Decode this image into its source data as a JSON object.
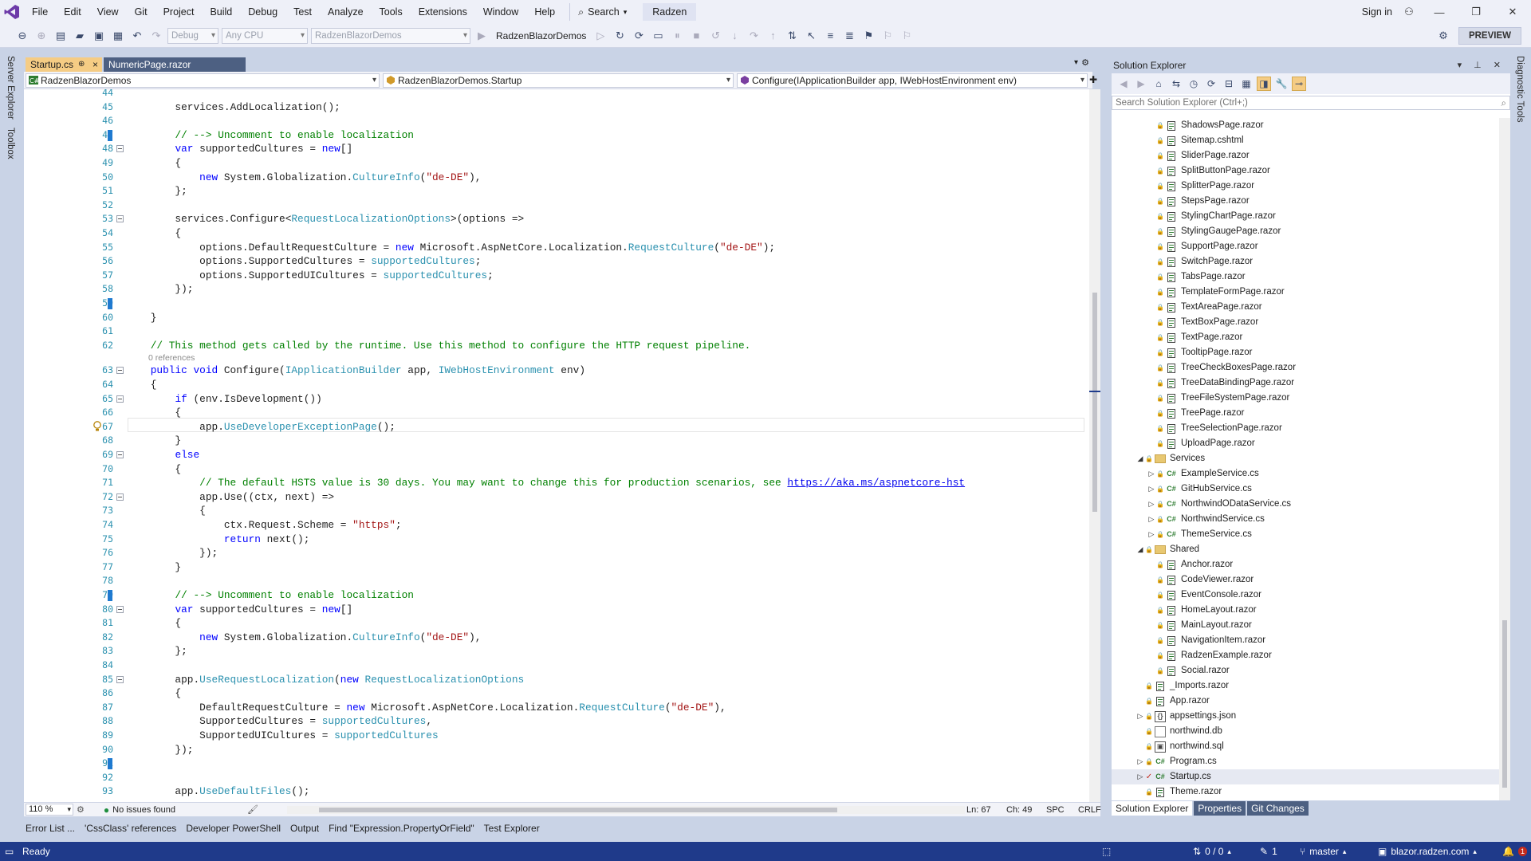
{
  "menubar": {
    "items": [
      "File",
      "Edit",
      "View",
      "Git",
      "Project",
      "Build",
      "Debug",
      "Test",
      "Analyze",
      "Tools",
      "Extensions",
      "Window",
      "Help"
    ],
    "search_label": "Search",
    "solution_name": "Radzen",
    "sign_in": "Sign in"
  },
  "toolbar": {
    "config": "Debug",
    "platform": "Any CPU",
    "startup_project": "RadzenBlazorDemos",
    "run_target": "RadzenBlazorDemos",
    "preview_label": "PREVIEW"
  },
  "left_rail": {
    "server_explorer": "Server Explorer",
    "toolbox": "Toolbox"
  },
  "right_rail": {
    "diagnostic_tools": "Diagnostic Tools"
  },
  "tabs": {
    "active": "Startup.cs",
    "active_pin": "⊕",
    "active_close": "×",
    "other": "NumericPage.razor"
  },
  "navbar": {
    "project": "RadzenBlazorDemos",
    "type": "RadzenBlazorDemos.Startup",
    "member": "Configure(IApplicationBuilder app, IWebHostEnvironment env)"
  },
  "editor": {
    "line_numbers": [
      "44",
      "45",
      "46",
      "47",
      "48",
      "49",
      "50",
      "51",
      "52",
      "53",
      "54",
      "55",
      "56",
      "57",
      "58",
      "59",
      "60",
      "61",
      "62",
      "63",
      "64",
      "65",
      "66",
      "67",
      "68",
      "69",
      "70",
      "71",
      "72",
      "73",
      "74",
      "75",
      "76",
      "77",
      "78",
      "79",
      "80",
      "81",
      "82",
      "83",
      "84",
      "85",
      "86",
      "87",
      "88",
      "89",
      "90",
      "91",
      "92",
      "93"
    ],
    "references_hint": "0 references",
    "lines": [
      [
        {
          "t": ""
        }
      ],
      [
        {
          "t": "        services."
        },
        {
          "t": "AddLocalization"
        },
        {
          "t": "();"
        }
      ],
      [
        {
          "t": ""
        }
      ],
      [
        {
          "t": "        "
        },
        {
          "t": "// --> Uncomment to enable localization",
          "c": "cm"
        }
      ],
      [
        {
          "t": "        "
        },
        {
          "t": "var",
          "c": "kw"
        },
        {
          "t": " supportedCultures = "
        },
        {
          "t": "new",
          "c": "kw"
        },
        {
          "t": "[]"
        }
      ],
      [
        {
          "t": "        {"
        }
      ],
      [
        {
          "t": "            "
        },
        {
          "t": "new",
          "c": "kw"
        },
        {
          "t": " System.Globalization."
        },
        {
          "t": "CultureInfo",
          "c": "ty"
        },
        {
          "t": "("
        },
        {
          "t": "\"de-DE\"",
          "c": "str"
        },
        {
          "t": "),"
        }
      ],
      [
        {
          "t": "        };"
        }
      ],
      [
        {
          "t": ""
        }
      ],
      [
        {
          "t": "        services."
        },
        {
          "t": "Configure"
        },
        {
          "t": "<"
        },
        {
          "t": "RequestLocalizationOptions",
          "c": "ty"
        },
        {
          "t": ">(options =>"
        }
      ],
      [
        {
          "t": "        {"
        }
      ],
      [
        {
          "t": "            options.DefaultRequestCulture = "
        },
        {
          "t": "new",
          "c": "kw"
        },
        {
          "t": " Microsoft.AspNetCore.Localization."
        },
        {
          "t": "RequestCulture",
          "c": "ty"
        },
        {
          "t": "("
        },
        {
          "t": "\"de-DE\"",
          "c": "str"
        },
        {
          "t": ");"
        }
      ],
      [
        {
          "t": "            options.SupportedCultures = "
        },
        {
          "t": "supportedCultures",
          "c": "ty"
        },
        {
          "t": ";"
        }
      ],
      [
        {
          "t": "            options.SupportedUICultures = "
        },
        {
          "t": "supportedCultures",
          "c": "ty"
        },
        {
          "t": ";"
        }
      ],
      [
        {
          "t": "        });"
        }
      ],
      [
        {
          "t": ""
        }
      ],
      [
        {
          "t": "    }"
        }
      ],
      [
        {
          "t": ""
        }
      ],
      [
        {
          "t": "    "
        },
        {
          "t": "// This method gets called by the runtime. Use this method to configure the HTTP request pipeline.",
          "c": "cm"
        }
      ],
      [
        {
          "t": "    "
        },
        {
          "t": "public",
          "c": "kw"
        },
        {
          "t": " "
        },
        {
          "t": "void",
          "c": "kw"
        },
        {
          "t": " Configure("
        },
        {
          "t": "IApplicationBuilder",
          "c": "ty"
        },
        {
          "t": " app, "
        },
        {
          "t": "IWebHostEnvironment",
          "c": "ty"
        },
        {
          "t": " env)"
        }
      ],
      [
        {
          "t": "    {"
        }
      ],
      [
        {
          "t": "        "
        },
        {
          "t": "if",
          "c": "kw"
        },
        {
          "t": " (env.IsDevelopment())"
        }
      ],
      [
        {
          "t": "        {"
        }
      ],
      [
        {
          "t": "            app."
        },
        {
          "t": "UseDeveloperExceptionPage",
          "c": "ty"
        },
        {
          "t": "();"
        }
      ],
      [
        {
          "t": "        }"
        }
      ],
      [
        {
          "t": "        "
        },
        {
          "t": "else",
          "c": "kw"
        }
      ],
      [
        {
          "t": "        {"
        }
      ],
      [
        {
          "t": "            "
        },
        {
          "t": "// The default HSTS value is 30 days. You may want to change this for production scenarios, see ",
          "c": "cm"
        },
        {
          "t": "https://aka.ms/aspnetcore-hst",
          "c": "link"
        }
      ],
      [
        {
          "t": "            app."
        },
        {
          "t": "Use"
        },
        {
          "t": "((ctx, next) =>"
        }
      ],
      [
        {
          "t": "            {"
        }
      ],
      [
        {
          "t": "                ctx.Request.Scheme = "
        },
        {
          "t": "\"https\"",
          "c": "str"
        },
        {
          "t": ";"
        }
      ],
      [
        {
          "t": "                "
        },
        {
          "t": "return",
          "c": "kw"
        },
        {
          "t": " next();"
        }
      ],
      [
        {
          "t": "            });"
        }
      ],
      [
        {
          "t": "        }"
        }
      ],
      [
        {
          "t": ""
        }
      ],
      [
        {
          "t": "        "
        },
        {
          "t": "// --> Uncomment to enable localization",
          "c": "cm"
        }
      ],
      [
        {
          "t": "        "
        },
        {
          "t": "var",
          "c": "kw"
        },
        {
          "t": " supportedCultures = "
        },
        {
          "t": "new",
          "c": "kw"
        },
        {
          "t": "[]"
        }
      ],
      [
        {
          "t": "        {"
        }
      ],
      [
        {
          "t": "            "
        },
        {
          "t": "new",
          "c": "kw"
        },
        {
          "t": " System.Globalization."
        },
        {
          "t": "CultureInfo",
          "c": "ty"
        },
        {
          "t": "("
        },
        {
          "t": "\"de-DE\"",
          "c": "str"
        },
        {
          "t": "),"
        }
      ],
      [
        {
          "t": "        };"
        }
      ],
      [
        {
          "t": ""
        }
      ],
      [
        {
          "t": "        app."
        },
        {
          "t": "UseRequestLocalization",
          "c": "ty"
        },
        {
          "t": "("
        },
        {
          "t": "new",
          "c": "kw"
        },
        {
          "t": " "
        },
        {
          "t": "RequestLocalizationOptions",
          "c": "ty"
        }
      ],
      [
        {
          "t": "        {"
        }
      ],
      [
        {
          "t": "            DefaultRequestCulture = "
        },
        {
          "t": "new",
          "c": "kw"
        },
        {
          "t": " Microsoft.AspNetCore.Localization."
        },
        {
          "t": "RequestCulture",
          "c": "ty"
        },
        {
          "t": "("
        },
        {
          "t": "\"de-DE\"",
          "c": "str"
        },
        {
          "t": "),"
        }
      ],
      [
        {
          "t": "            SupportedCultures = "
        },
        {
          "t": "supportedCultures",
          "c": "ty"
        },
        {
          "t": ","
        }
      ],
      [
        {
          "t": "            SupportedUICultures = "
        },
        {
          "t": "supportedCultures",
          "c": "ty"
        }
      ],
      [
        {
          "t": "        });"
        }
      ],
      [
        {
          "t": ""
        }
      ],
      [
        {
          "t": ""
        }
      ],
      [
        {
          "t": "        app."
        },
        {
          "t": "UseDefaultFiles",
          "c": "ty"
        },
        {
          "t": "();"
        }
      ]
    ]
  },
  "editor_status": {
    "zoom": "110 %",
    "issues": "No issues found",
    "ln": "Ln: 67",
    "ch": "Ch: 49",
    "mode": "SPC",
    "eol": "CRLF"
  },
  "solution_explorer": {
    "title": "Solution Explorer",
    "search_placeholder": "Search Solution Explorer (Ctrl+;)",
    "items": [
      {
        "label": "ShadowsPage.razor",
        "level": 3,
        "type": "razor",
        "exp": ""
      },
      {
        "label": "Sitemap.cshtml",
        "level": 3,
        "type": "razor",
        "exp": ""
      },
      {
        "label": "SliderPage.razor",
        "level": 3,
        "type": "razor",
        "exp": ""
      },
      {
        "label": "SplitButtonPage.razor",
        "level": 3,
        "type": "razor",
        "exp": ""
      },
      {
        "label": "SplitterPage.razor",
        "level": 3,
        "type": "razor",
        "exp": ""
      },
      {
        "label": "StepsPage.razor",
        "level": 3,
        "type": "razor",
        "exp": ""
      },
      {
        "label": "StylingChartPage.razor",
        "level": 3,
        "type": "razor",
        "exp": ""
      },
      {
        "label": "StylingGaugePage.razor",
        "level": 3,
        "type": "razor",
        "exp": ""
      },
      {
        "label": "SupportPage.razor",
        "level": 3,
        "type": "razor",
        "exp": ""
      },
      {
        "label": "SwitchPage.razor",
        "level": 3,
        "type": "razor",
        "exp": ""
      },
      {
        "label": "TabsPage.razor",
        "level": 3,
        "type": "razor",
        "exp": ""
      },
      {
        "label": "TemplateFormPage.razor",
        "level": 3,
        "type": "razor",
        "exp": ""
      },
      {
        "label": "TextAreaPage.razor",
        "level": 3,
        "type": "razor",
        "exp": ""
      },
      {
        "label": "TextBoxPage.razor",
        "level": 3,
        "type": "razor",
        "exp": ""
      },
      {
        "label": "TextPage.razor",
        "level": 3,
        "type": "razor",
        "exp": ""
      },
      {
        "label": "TooltipPage.razor",
        "level": 3,
        "type": "razor",
        "exp": ""
      },
      {
        "label": "TreeCheckBoxesPage.razor",
        "level": 3,
        "type": "razor",
        "exp": ""
      },
      {
        "label": "TreeDataBindingPage.razor",
        "level": 3,
        "type": "razor",
        "exp": ""
      },
      {
        "label": "TreeFileSystemPage.razor",
        "level": 3,
        "type": "razor",
        "exp": ""
      },
      {
        "label": "TreePage.razor",
        "level": 3,
        "type": "razor",
        "exp": ""
      },
      {
        "label": "TreeSelectionPage.razor",
        "level": 3,
        "type": "razor",
        "exp": ""
      },
      {
        "label": "UploadPage.razor",
        "level": 3,
        "type": "razor",
        "exp": ""
      },
      {
        "label": "Services",
        "level": 2,
        "type": "folder",
        "exp": "◢"
      },
      {
        "label": "ExampleService.cs",
        "level": 3,
        "type": "cs",
        "exp": "▷"
      },
      {
        "label": "GitHubService.cs",
        "level": 3,
        "type": "cs",
        "exp": "▷"
      },
      {
        "label": "NorthwindODataService.cs",
        "level": 3,
        "type": "cs",
        "exp": "▷"
      },
      {
        "label": "NorthwindService.cs",
        "level": 3,
        "type": "cs",
        "exp": "▷"
      },
      {
        "label": "ThemeService.cs",
        "level": 3,
        "type": "cs",
        "exp": "▷"
      },
      {
        "label": "Shared",
        "level": 2,
        "type": "folder",
        "exp": "◢"
      },
      {
        "label": "Anchor.razor",
        "level": 3,
        "type": "razor",
        "exp": ""
      },
      {
        "label": "CodeViewer.razor",
        "level": 3,
        "type": "razor",
        "exp": ""
      },
      {
        "label": "EventConsole.razor",
        "level": 3,
        "type": "razor",
        "exp": ""
      },
      {
        "label": "HomeLayout.razor",
        "level": 3,
        "type": "razor",
        "exp": ""
      },
      {
        "label": "MainLayout.razor",
        "level": 3,
        "type": "razor",
        "exp": ""
      },
      {
        "label": "NavigationItem.razor",
        "level": 3,
        "type": "razor",
        "exp": ""
      },
      {
        "label": "RadzenExample.razor",
        "level": 3,
        "type": "razor",
        "exp": ""
      },
      {
        "label": "Social.razor",
        "level": 3,
        "type": "razor",
        "exp": ""
      },
      {
        "label": "_Imports.razor",
        "level": 2,
        "type": "razor",
        "exp": ""
      },
      {
        "label": "App.razor",
        "level": 2,
        "type": "razor",
        "exp": ""
      },
      {
        "label": "appsettings.json",
        "level": 2,
        "type": "json",
        "exp": "▷"
      },
      {
        "label": "northwind.db",
        "level": 2,
        "type": "db",
        "exp": ""
      },
      {
        "label": "northwind.sql",
        "level": 2,
        "type": "sql",
        "exp": ""
      },
      {
        "label": "Program.cs",
        "level": 2,
        "type": "cs",
        "exp": "▷"
      },
      {
        "label": "Startup.cs",
        "level": 2,
        "type": "cs",
        "exp": "▷",
        "modified": true,
        "selected": true
      },
      {
        "label": "Theme.razor",
        "level": 2,
        "type": "razor",
        "exp": ""
      }
    ],
    "bottom_tabs": [
      "Solution Explorer",
      "Properties",
      "Git Changes"
    ]
  },
  "bottom_tool_tabs": [
    "Error List ...",
    "'CssClass' references",
    "Developer PowerShell",
    "Output",
    "Find \"Expression.PropertyOrField\"",
    "Test Explorer"
  ],
  "statusbar": {
    "ready": "Ready",
    "sync": "0 / 0",
    "pencil_count": "1",
    "branch": "master",
    "repo": "blazor.radzen.com",
    "notif_count": "1"
  },
  "colors": {
    "accent": "#1f3a8a",
    "active_tab": "#f5cc84",
    "keyword": "#0000ff",
    "type": "#2b91af",
    "string": "#a31515",
    "comment": "#008000"
  }
}
